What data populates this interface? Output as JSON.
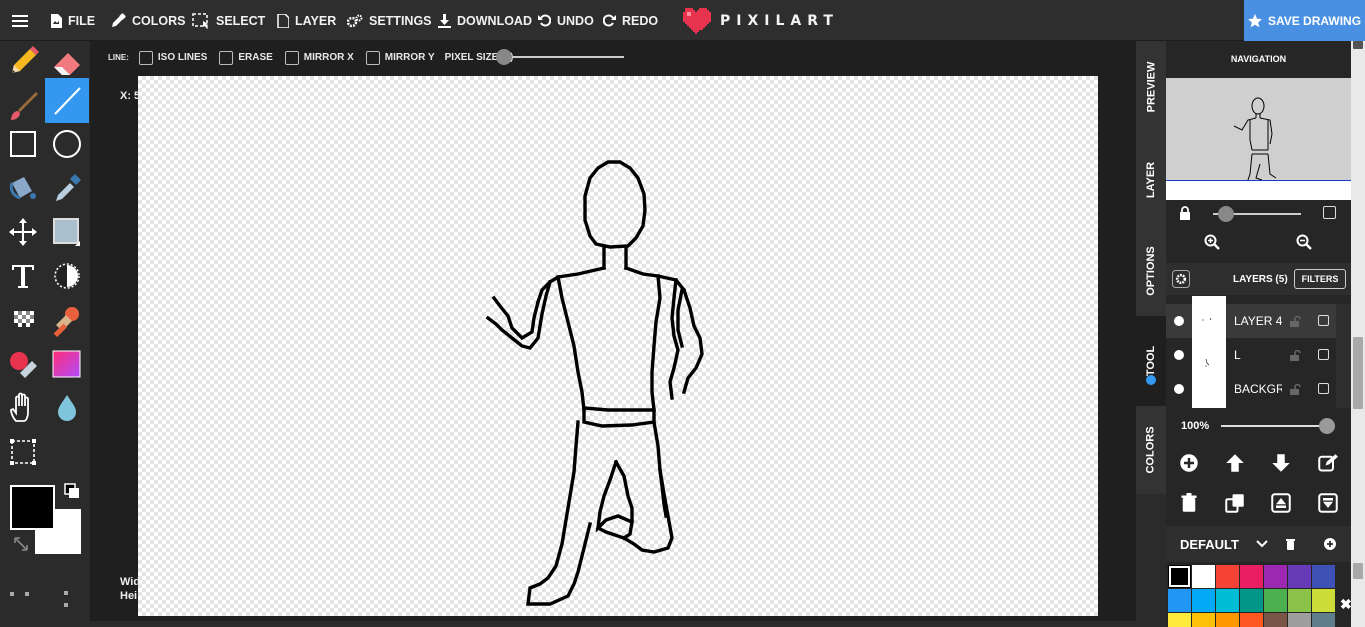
{
  "topbar": {
    "menu_icon": "hamburger-icon",
    "file": "FILE",
    "colors": "COLORS",
    "select": "SELECT",
    "layer": "LAYER",
    "settings": "SETTINGS",
    "download": "DOWNLOAD",
    "undo": "UNDO",
    "redo": "REDO",
    "logo": "PIXILART",
    "save": "SAVE DRAWING",
    "accent": "#4a90e2",
    "logo_color": "#e8334f"
  },
  "options": {
    "line_label": "LINE:",
    "iso_lines": "ISO LINES",
    "erase": "ERASE",
    "mirror_x": "MIRROR X",
    "mirror_y": "MIRROR Y",
    "pixel_size": "PIXEL SIZE (1)"
  },
  "canvas": {
    "coord_x": "X: 5",
    "width_label": "Wid",
    "height_label": "Hei"
  },
  "tabs": {
    "preview": "PREVIEW",
    "layer": "LAYER",
    "options": "OPTIONS",
    "tool": "TOOL",
    "colors": "COLORS"
  },
  "panel": {
    "navigation": "NAVIGATION",
    "layers_count": "LAYERS (5)",
    "filters": "FILTERS",
    "layers": [
      {
        "name": "LAYER 4"
      },
      {
        "name": "L"
      },
      {
        "name": "BACKGRO"
      }
    ],
    "zoom": "100%",
    "palette_name": "DEFAULT"
  },
  "palette": [
    "#000000",
    "#ffffff",
    "#f44336",
    "#e91e63",
    "#9c27b0",
    "#673ab7",
    "#3f51b5",
    "#2196f3",
    "#03a9f4",
    "#00bcd4",
    "#009688",
    "#4caf50",
    "#8bc34a",
    "#cddc39",
    "#ffeb3b",
    "#ffc107",
    "#ff9800",
    "#ff5722",
    "#795548",
    "#9e9e9e",
    "#607d8b"
  ]
}
